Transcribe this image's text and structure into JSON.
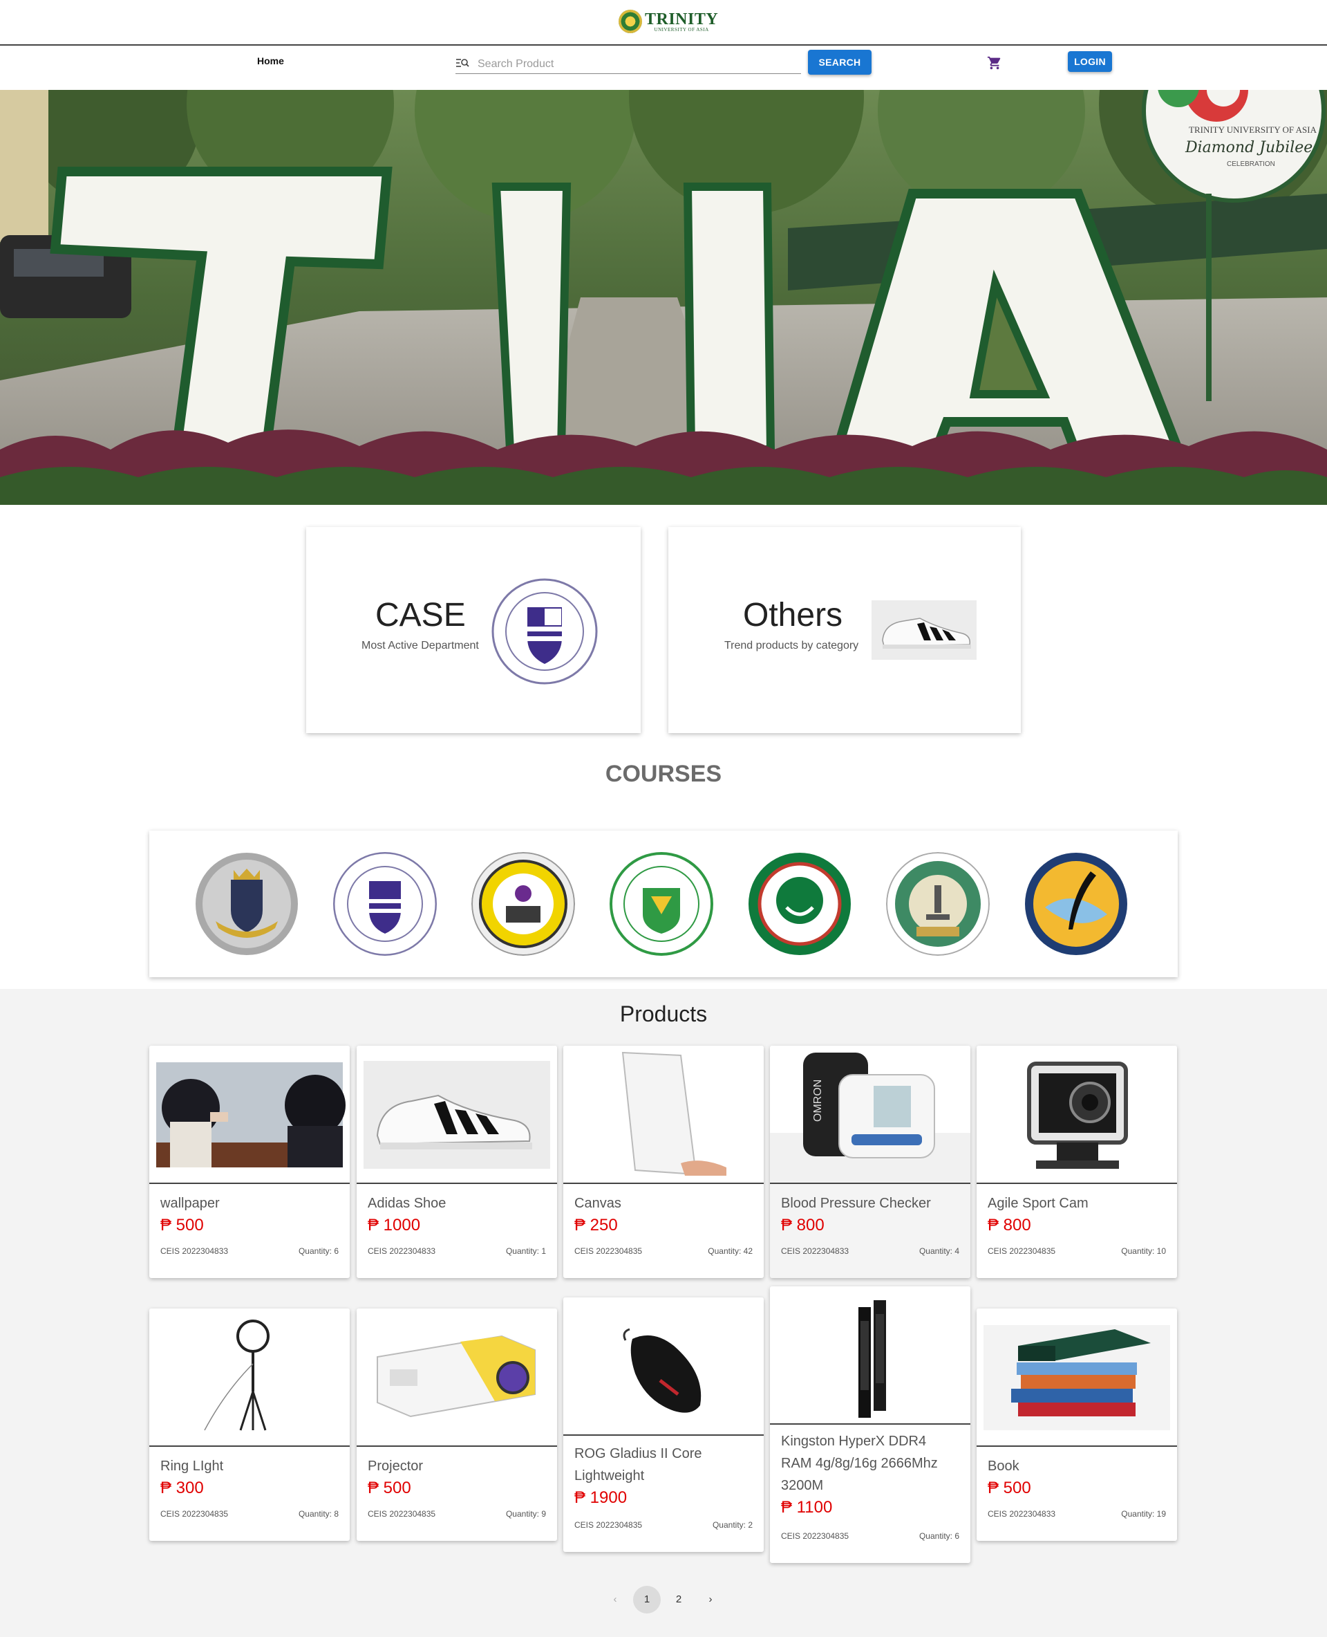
{
  "header": {
    "logo_main": "TRINITY",
    "logo_sub": "UNIVERSITY OF ASIA"
  },
  "nav": {
    "home": "Home",
    "search_placeholder": "Search Product",
    "search_button": "SEARCH",
    "login_button": "LOGIN",
    "cart_icon": "shopping-cart-icon",
    "search_icon": "list-search-icon"
  },
  "hero": {
    "sign_line1": "TRINITY UNIVERSITY OF ASIA",
    "sign_line2": "Diamond Jubilee",
    "sign_line3": "CELEBRATION"
  },
  "features": {
    "case": {
      "title": "CASE",
      "subtitle": "Most Active Department"
    },
    "others": {
      "title": "Others",
      "subtitle": "Trend products by category"
    }
  },
  "courses": {
    "title": "COURSES",
    "logos": [
      "allied-health-sciences-seal",
      "arts-sciences-education-seal",
      "business-management-seal",
      "engineering-information-sciences-seal",
      "hospitality-tourism-seal",
      "medical-technology-seal",
      "journalism-quill-seal"
    ]
  },
  "products": {
    "title": "Products",
    "items": [
      {
        "name": "wallpaper",
        "price": "₱ 500",
        "code": "CEIS 2022304833",
        "quantity": "Quantity: 6"
      },
      {
        "name": "Adidas Shoe",
        "price": "₱ 1000",
        "code": "CEIS 2022304833",
        "quantity": "Quantity: 1"
      },
      {
        "name": "Canvas",
        "price": "₱ 250",
        "code": "CEIS 2022304835",
        "quantity": "Quantity: 42"
      },
      {
        "name": "Blood Pressure Checker",
        "price": "₱ 800",
        "code": "CEIS 2022304833",
        "quantity": "Quantity: 4"
      },
      {
        "name": "Agile Sport Cam",
        "price": "₱ 800",
        "code": "CEIS 2022304835",
        "quantity": "Quantity: 10"
      },
      {
        "name": "Ring LIght",
        "price": "₱ 300",
        "code": "CEIS 2022304835",
        "quantity": "Quantity: 8"
      },
      {
        "name": "Projector",
        "price": "₱ 500",
        "code": "CEIS 2022304835",
        "quantity": "Quantity: 9"
      },
      {
        "name": "ROG Gladius II Core Lightweight",
        "price": "₱ 1900",
        "code": "CEIS 2022304835",
        "quantity": "Quantity: 2"
      },
      {
        "name": "Kingston HyperX DDR4 RAM 4g/8g/16g 2666Mhz 3200M",
        "price": "₱ 1100",
        "code": "CEIS 2022304835",
        "quantity": "Quantity: 6"
      },
      {
        "name": "Book",
        "price": "₱ 500",
        "code": "CEIS 2022304833",
        "quantity": "Quantity: 19"
      }
    ]
  },
  "pagination": {
    "prev": "‹",
    "page1": "1",
    "page2": "2",
    "next": "›"
  },
  "colors": {
    "accent": "#1976d2",
    "price": "#e00000",
    "brand_green": "#1f5e2a"
  }
}
